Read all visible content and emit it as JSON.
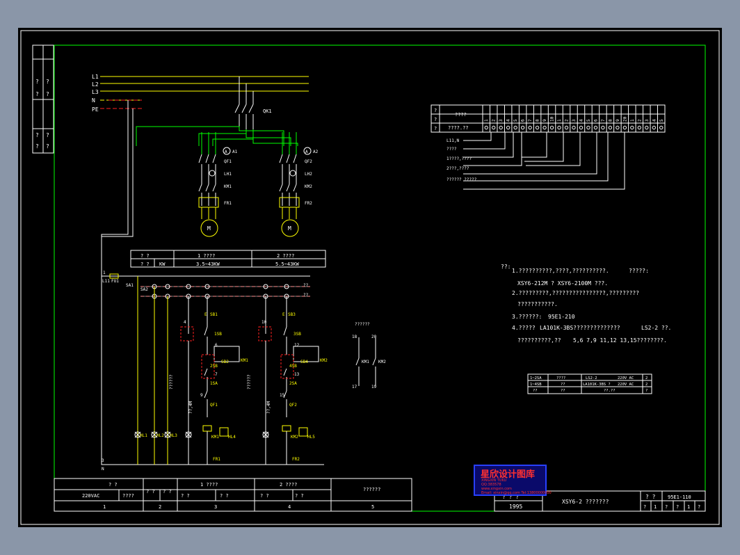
{
  "colors": {
    "sheet_bg": "#000000",
    "frame": "#ffffff",
    "inner_frame": "#00ff00",
    "wire": "#ffff00",
    "text": "#ffffff",
    "neutral": "#ff0000",
    "green": "#00ff00"
  },
  "supply": {
    "l1": "L1",
    "l2": "L2",
    "l3": "L3",
    "n": "N",
    "pe": "PE"
  },
  "left_strip": {
    "cells": [
      "?",
      "?",
      "?",
      "?",
      "?",
      "?",
      "?",
      "?"
    ]
  },
  "power": {
    "qk": "QK1",
    "m1": {
      "ammeter": "A",
      "ammeter_label": "A1",
      "qf": "QF1",
      "lh": "LH1",
      "km": "KM1",
      "fr": "FR1",
      "motor": "M"
    },
    "m2": {
      "ammeter": "A",
      "ammeter_label": "A2",
      "qf": "QF2",
      "lh": "LH2",
      "km": "KM2",
      "fr": "FR2",
      "motor": "M"
    }
  },
  "rating_table": {
    "r1": [
      "? ?",
      "1 ????",
      "2 ????"
    ],
    "r2": [
      "? ?",
      "KW",
      "3.5~43KW",
      "5.5~43KW"
    ]
  },
  "control": {
    "l11": "L11",
    "fu1": "FU1",
    "sa1": "SA1",
    "sa2": "SA2",
    "num1": "1",
    "num3": "3",
    "n": "N",
    "qq1": "??",
    "qq2": "??",
    "ch1": {
      "n4": "4",
      "e": "E",
      "sb1": "SB1",
      "n7": "7",
      "sb": "1SB",
      "n6": "6",
      "n2sb": "2SB",
      "sb2": "SB2",
      "km": "KM1",
      "n7b": "7",
      "n8": "8",
      "sa": "1SA",
      "n9": "9",
      "qf": "QF1",
      "km2": "KM1",
      "hl": "HL4",
      "fr": "FR1",
      "vert": "??????",
      "vert2": "??,4M"
    },
    "ch2": {
      "n10": "10",
      "n11": "11",
      "e": "E",
      "sb3": "SB3",
      "sb": "3SB",
      "n12": "12",
      "n4sb": "4SB",
      "sb4": "SB4",
      "km": "KM2",
      "n13": "13",
      "n14": "14",
      "sa": "2SA",
      "n15": "15",
      "qf": "QF2",
      "km2": "KM2",
      "hl": "HL5",
      "fr": "FR2",
      "vert": "??????",
      "vert2": "??,4M"
    },
    "hl1": "HL1",
    "hl2": "HL2",
    "hl3": "HL3",
    "aux": {
      "title": "??????",
      "n18": "18",
      "n20": "20",
      "km1": "KM1",
      "km2": "KM2",
      "n17": "17",
      "n19": "19"
    }
  },
  "terminal": {
    "head1": "????",
    "head2": "????.??",
    "nums": [
      "1",
      "2",
      "3",
      "4",
      "5",
      "6",
      "7",
      "8",
      "9",
      "10",
      "1",
      "2",
      "3",
      "4",
      "5",
      "6",
      "7",
      "8",
      "9",
      "20",
      "1",
      "2",
      "3",
      "4",
      "5"
    ],
    "sidecells": [
      "?",
      "?",
      "?",
      "?",
      "?",
      "?"
    ],
    "labels": [
      "L11,N",
      "????",
      "1????,????",
      "2???,????",
      "?????? ?????"
    ]
  },
  "notes": {
    "head": "??:",
    "n1a": "1.??????????,????,??????????.",
    "n1b": "?????:",
    "n1c": "XSY6-212M ? XSY6-2100M ???.",
    "n2a": "2.?????????,????????????????,?????????",
    "n2b": "???????????.",
    "n3a": "3.??????:",
    "n3b": "95E1-210",
    "n4a": "4.?????",
    "n4b": "LA101K-3BS??????????????",
    "n4c": "LS2-2 ??.",
    "n4d": "??????????,??",
    "n4e": "5,6  7,9  11,12  13,15????????."
  },
  "parts_table": {
    "rows": [
      [
        "1~2SA",
        "????",
        "LS2-2",
        "220V AC",
        "2"
      ],
      [
        "1~4SB",
        "??",
        "LA101K-3BS ?",
        "220V AC",
        "2"
      ],
      [
        "??",
        "??",
        "",
        "??.??",
        "?"
      ]
    ]
  },
  "bottom_table": {
    "h": [
      "? ?",
      "1 ????",
      "2 ????",
      "??????"
    ],
    "r2": [
      "220VAC",
      "????",
      "? ?",
      "? ?",
      "? ?",
      "? ?",
      "? ?",
      "? ?",
      "? ?",
      "? ?"
    ],
    "r3": [
      "1",
      "2",
      "3",
      "4",
      "5"
    ]
  },
  "title_block": {
    "c1": "? ? ?",
    "year": "1995",
    "title": "XSY6-2 ???????",
    "c3": "? ?",
    "code": "95E1-110",
    "row2": [
      "?",
      "1",
      "?",
      "?",
      "1",
      "?"
    ]
  },
  "logo": {
    "line1": "星欣设计图库",
    "line2": "XINGXIN TUKU",
    "line3": "QQ:383578",
    "line4": "www.xingxin.com",
    "line5": "Email: xinxin@qq.com  Tel:13800000000"
  }
}
